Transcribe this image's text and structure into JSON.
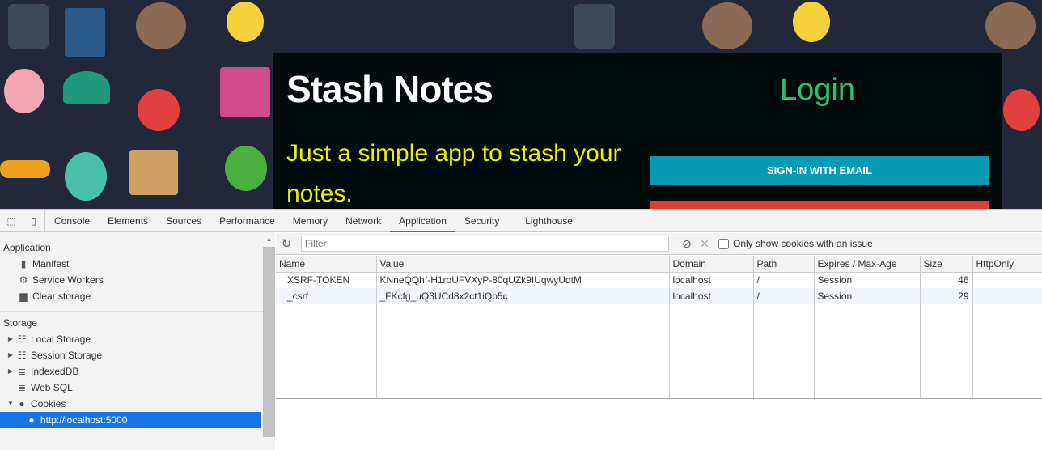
{
  "app": {
    "title": "Stash Notes",
    "tagline": "Just a simple app to stash your notes.",
    "login_heading": "Login",
    "signin_email": "SIGN-IN WITH EMAIL",
    "colors": {
      "card_bg": "#010b0b",
      "title": "#ffffff",
      "tagline": "#e6f000",
      "login": "#2fbf71",
      "signin_button": "#079bb3",
      "second_button": "#db4132"
    }
  },
  "devtools": {
    "tabs": [
      "Console",
      "Elements",
      "Sources",
      "Performance",
      "Memory",
      "Network",
      "Application",
      "Security",
      "Lighthouse"
    ],
    "active_tab": "Application",
    "sidebar": {
      "application_header": "Application",
      "application_items": [
        {
          "label": "Manifest",
          "icon": "file-icon"
        },
        {
          "label": "Service Workers",
          "icon": "gear-icon"
        },
        {
          "label": "Clear storage",
          "icon": "trash-icon"
        }
      ],
      "storage_header": "Storage",
      "storage_items": [
        {
          "label": "Local Storage",
          "icon": "grid-icon",
          "expandable": true
        },
        {
          "label": "Session Storage",
          "icon": "grid-icon",
          "expandable": true
        },
        {
          "label": "IndexedDB",
          "icon": "database-icon",
          "expandable": true
        },
        {
          "label": "Web SQL",
          "icon": "database-icon",
          "expandable": false
        },
        {
          "label": "Cookies",
          "icon": "cookie-icon",
          "expanded": true
        }
      ],
      "selected_item": "http://localhost:5000"
    },
    "toolbar": {
      "filter_placeholder": "Filter",
      "only_issues_label": "Only show cookies with an issue",
      "only_issues_checked": false
    },
    "cookies": {
      "columns": [
        "Name",
        "Value",
        "Domain",
        "Path",
        "Expires / Max-Age",
        "Size",
        "HttpOnly"
      ],
      "rows": [
        {
          "name": "XSRF-TOKEN",
          "value": "KNneQQhf-H1roUFVXyP-80qUZk9IUqwyUdtM",
          "domain": "localhost",
          "path": "/",
          "expires": "Session",
          "size": "46",
          "httponly": ""
        },
        {
          "name": "_csrf",
          "value": "_FKcfg_uQ3UCd8x2ct1iQp5c",
          "domain": "localhost",
          "path": "/",
          "expires": "Session",
          "size": "29",
          "httponly": ""
        }
      ]
    }
  }
}
